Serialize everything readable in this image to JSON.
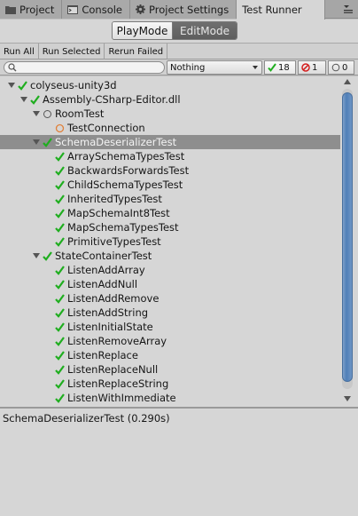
{
  "tabs": [
    {
      "label": "Project",
      "icon": "folder-icon"
    },
    {
      "label": "Console",
      "icon": "console-icon"
    },
    {
      "label": "Project Settings",
      "icon": "gear-icon"
    },
    {
      "label": "Test Runner",
      "icon": ""
    }
  ],
  "mode": {
    "play": "PlayMode",
    "edit": "EditMode",
    "selected": "EditMode"
  },
  "toolbar": {
    "run_all": "Run All",
    "run_selected": "Run Selected",
    "rerun_failed": "Rerun Failed"
  },
  "filter": {
    "search_value": "",
    "category_selected": "Nothing",
    "passed": "18",
    "failed": "1",
    "skipped": "0"
  },
  "tree": [
    {
      "label": "colyseus-unity3d",
      "depth": 0,
      "expanded": true,
      "status": "pass"
    },
    {
      "label": "Assembly-CSharp-Editor.dll",
      "depth": 1,
      "expanded": true,
      "status": "pass"
    },
    {
      "label": "RoomTest",
      "depth": 2,
      "expanded": true,
      "status": "none"
    },
    {
      "label": "TestConnection",
      "depth": 3,
      "status": "inconclusive"
    },
    {
      "label": "SchemaDeserializerTest",
      "depth": 2,
      "expanded": true,
      "status": "pass",
      "selected": true
    },
    {
      "label": "ArraySchemaTypesTest",
      "depth": 3,
      "status": "pass"
    },
    {
      "label": "BackwardsForwardsTest",
      "depth": 3,
      "status": "pass"
    },
    {
      "label": "ChildSchemaTypesTest",
      "depth": 3,
      "status": "pass"
    },
    {
      "label": "InheritedTypesTest",
      "depth": 3,
      "status": "pass"
    },
    {
      "label": "MapSchemaInt8Test",
      "depth": 3,
      "status": "pass"
    },
    {
      "label": "MapSchemaTypesTest",
      "depth": 3,
      "status": "pass"
    },
    {
      "label": "PrimitiveTypesTest",
      "depth": 3,
      "status": "pass"
    },
    {
      "label": "StateContainerTest",
      "depth": 2,
      "expanded": true,
      "status": "pass"
    },
    {
      "label": "ListenAddArray",
      "depth": 3,
      "status": "pass"
    },
    {
      "label": "ListenAddNull",
      "depth": 3,
      "status": "pass"
    },
    {
      "label": "ListenAddRemove",
      "depth": 3,
      "status": "pass"
    },
    {
      "label": "ListenAddString",
      "depth": 3,
      "status": "pass"
    },
    {
      "label": "ListenInitialState",
      "depth": 3,
      "status": "pass"
    },
    {
      "label": "ListenRemoveArray",
      "depth": 3,
      "status": "pass"
    },
    {
      "label": "ListenReplace",
      "depth": 3,
      "status": "pass"
    },
    {
      "label": "ListenReplaceNull",
      "depth": 3,
      "status": "pass"
    },
    {
      "label": "ListenReplaceString",
      "depth": 3,
      "status": "pass"
    },
    {
      "label": "ListenWithImmediate",
      "depth": 3,
      "status": "pass"
    }
  ],
  "details": {
    "text": "SchemaDeserializerTest (0.290s)"
  },
  "colors": {
    "pass": "#1fae1f",
    "fail": "#d42020",
    "inconclusive": "#e0813a",
    "selected_row": "#8e8e8e",
    "scroll_thumb": "#5a86bd"
  }
}
